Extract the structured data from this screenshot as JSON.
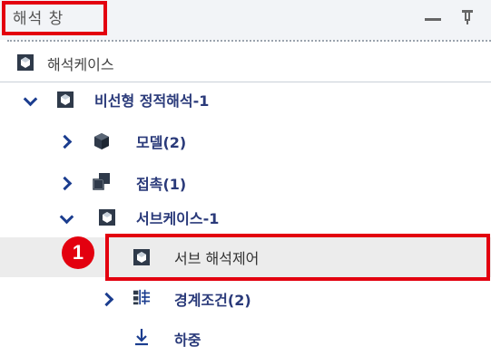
{
  "panel": {
    "title": "해석 창",
    "case_header": "해석케이스"
  },
  "tree": {
    "nonlinear_static": "비선형 정적해석-1",
    "model": "모델(2)",
    "contact": "접촉(1)",
    "subcase": "서브케이스-1",
    "sub_analysis_control": "서브 해석제어",
    "boundary": "경계조건(2)",
    "load": "하중"
  },
  "annotation": {
    "step_number": "1"
  },
  "colors": {
    "highlight": "#e3000f",
    "tree_text": "#2a3a7a",
    "icon_dark": "#2f3a4a"
  },
  "icons": {
    "case": "analysis-case-icon",
    "model": "model-cube-icon",
    "contact": "contact-icon",
    "subcase": "subcase-icon",
    "control": "analysis-control-icon",
    "boundary": "boundary-condition-icon",
    "load": "load-arrow-icon"
  }
}
